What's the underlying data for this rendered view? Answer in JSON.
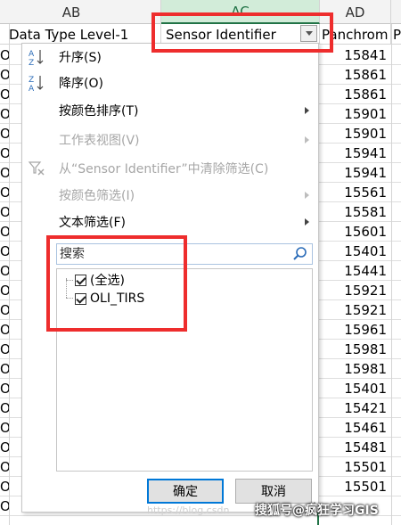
{
  "columns": {
    "ab": "AB",
    "ac": "AC",
    "ad": "AD"
  },
  "header_cells": {
    "data_type": "Data Type Level-1",
    "sensor": "Sensor Identifier",
    "panchrom": "Panchrom",
    "next": "P"
  },
  "rows": [
    {
      "o": "O",
      "v": "15841"
    },
    {
      "o": "O",
      "v": "15861"
    },
    {
      "o": "O",
      "v": "15861"
    },
    {
      "o": "O",
      "v": "15901"
    },
    {
      "o": "O",
      "v": "15901"
    },
    {
      "o": "O",
      "v": "15941"
    },
    {
      "o": "O",
      "v": "15941"
    },
    {
      "o": "O",
      "v": "15561"
    },
    {
      "o": "O",
      "v": "15581"
    },
    {
      "o": "O",
      "v": "15601"
    },
    {
      "o": "O",
      "v": "15401"
    },
    {
      "o": "O",
      "v": "15441"
    },
    {
      "o": "O",
      "v": "15921"
    },
    {
      "o": "O",
      "v": "15921"
    },
    {
      "o": "O",
      "v": "15961"
    },
    {
      "o": "O",
      "v": "15981"
    },
    {
      "o": "O",
      "v": "15981"
    },
    {
      "o": "O",
      "v": "15401"
    },
    {
      "o": "O",
      "v": "15421"
    },
    {
      "o": "O",
      "v": "15461"
    },
    {
      "o": "O",
      "v": "15481"
    },
    {
      "o": "O",
      "v": "15501"
    },
    {
      "o": "O",
      "v": "15501"
    },
    {
      "o": "O",
      "v": ""
    }
  ],
  "menu": {
    "sort_asc": "升序(S)",
    "sort_desc": "降序(O)",
    "sort_by_color": "按颜色排序(T)",
    "sheet_view": "工作表视图(V)",
    "clear_filter": "从“Sensor Identifier”中清除筛选(C)",
    "filter_by_color": "按颜色筛选(I)",
    "text_filter": "文本筛选(F)",
    "search_placeholder": "搜索",
    "items": [
      {
        "label": "(全选)",
        "checked": true
      },
      {
        "label": "OLI_TIRS",
        "checked": true
      }
    ],
    "ok": "确定",
    "cancel": "取消"
  },
  "watermark": "搜狐号@疯狂学习GIS",
  "watermark_url": "https://blog.csdn",
  "colors": {
    "highlight": "#ee2d2d",
    "selected_column": "#217346"
  }
}
